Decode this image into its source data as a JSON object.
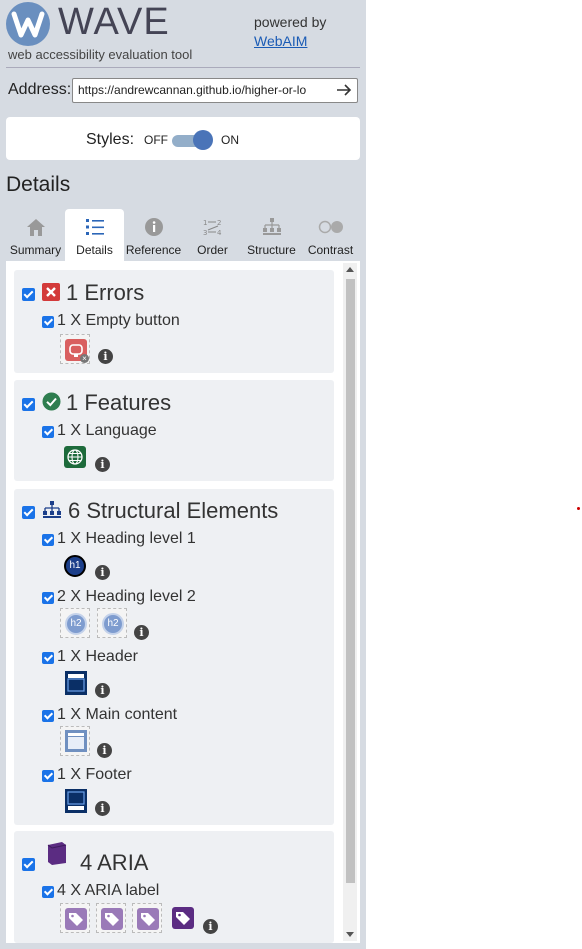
{
  "header": {
    "logo_letter": "W",
    "logo_word": "WAVE",
    "subtitle": "web accessibility evaluation tool",
    "powered_by": "powered by",
    "webaim_link": "WebAIM"
  },
  "address": {
    "label": "Address:",
    "value": "https://andrewcannan.github.io/higher-or-lo",
    "go_icon": "arrow-right-icon"
  },
  "styles": {
    "label": "Styles:",
    "off": "OFF",
    "on": "ON",
    "state": "on"
  },
  "details_title": "Details",
  "tabs": [
    {
      "label": "Summary",
      "icon": "home-icon"
    },
    {
      "label": "Details",
      "icon": "list-icon",
      "active": true
    },
    {
      "label": "Reference",
      "icon": "info-icon"
    },
    {
      "label": "Order",
      "icon": "order-icon"
    },
    {
      "label": "Structure",
      "icon": "structure-icon"
    },
    {
      "label": "Contrast",
      "icon": "contrast-icon"
    }
  ],
  "sections": {
    "errors": {
      "title": "1 Errors",
      "items": [
        {
          "label": "1 X Empty button"
        }
      ]
    },
    "features": {
      "title": "1 Features",
      "items": [
        {
          "label": "1 X Language"
        }
      ]
    },
    "structure": {
      "title": "6 Structural Elements",
      "items": [
        {
          "label": "1 X Heading level 1",
          "badge": "h1"
        },
        {
          "label": "2 X Heading level 2",
          "badge": "h2"
        },
        {
          "label": "1 X Header"
        },
        {
          "label": "1 X Main content"
        },
        {
          "label": "1 X Footer"
        }
      ]
    },
    "aria": {
      "title": "4 ARIA",
      "items": [
        {
          "label": "4 X ARIA label"
        }
      ]
    }
  },
  "info_glyph": "i",
  "colors": {
    "panel_bg": "#d6dbe2",
    "error_red": "#d33a3a",
    "feature_green": "#1d6b3b",
    "structure_blue": "#1c3f8a",
    "aria_purple": "#5b2c82",
    "link_blue": "#1a5bb5"
  }
}
